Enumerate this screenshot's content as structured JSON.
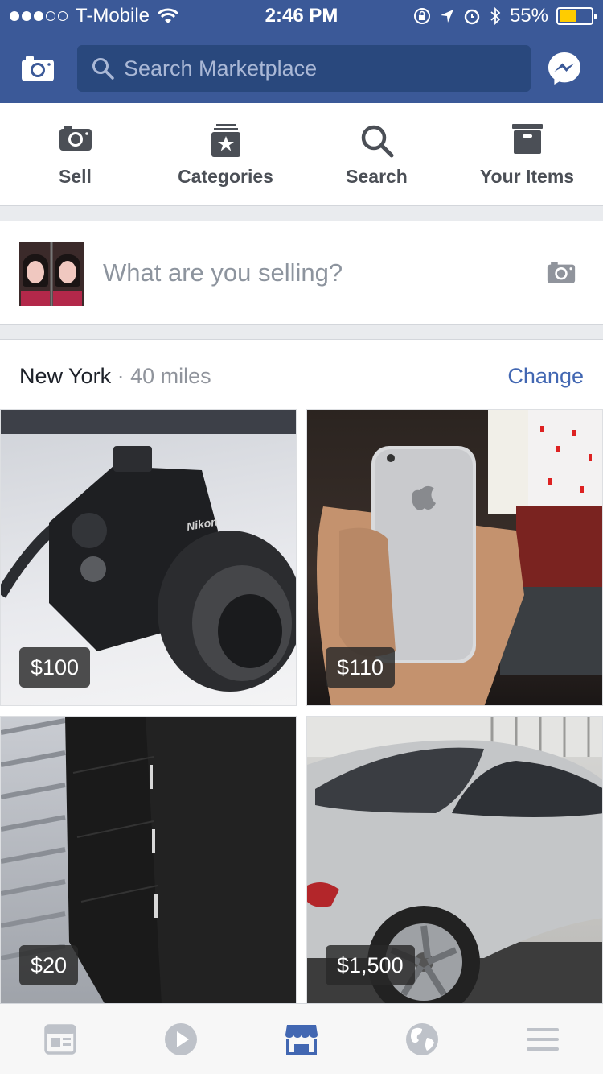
{
  "status_bar": {
    "carrier": "T-Mobile",
    "signal_bars": [
      true,
      true,
      true,
      false,
      false
    ],
    "time": "2:46 PM",
    "battery_percent": "55%",
    "battery_level": 0.55
  },
  "header": {
    "search_placeholder": "Search Marketplace",
    "colors": {
      "brand": "#3b5998",
      "search_bg": "#29487d"
    }
  },
  "actions": [
    {
      "label": "Sell",
      "icon": "camera-icon"
    },
    {
      "label": "Categories",
      "icon": "categories-icon"
    },
    {
      "label": "Search",
      "icon": "search-icon"
    },
    {
      "label": "Your Items",
      "icon": "box-icon"
    }
  ],
  "composer": {
    "prompt": "What are you selling?"
  },
  "feed": {
    "location": "New York",
    "separator": "·",
    "distance": "40 miles",
    "change_label": "Change",
    "listings": [
      {
        "price": "$100",
        "item": "Nikon camera"
      },
      {
        "price": "$110",
        "item": "iPhone"
      },
      {
        "price": "$20",
        "item": "Black dresser"
      },
      {
        "price": "$1,500",
        "item": "Silver car"
      }
    ]
  },
  "tabbar": {
    "tabs": [
      "news-feed-icon",
      "video-icon",
      "marketplace-icon",
      "notifications-globe-icon",
      "menu-icon"
    ],
    "active_tab": "marketplace-icon",
    "colors": {
      "active": "#4267b2",
      "inactive": "#bec2c9"
    }
  }
}
